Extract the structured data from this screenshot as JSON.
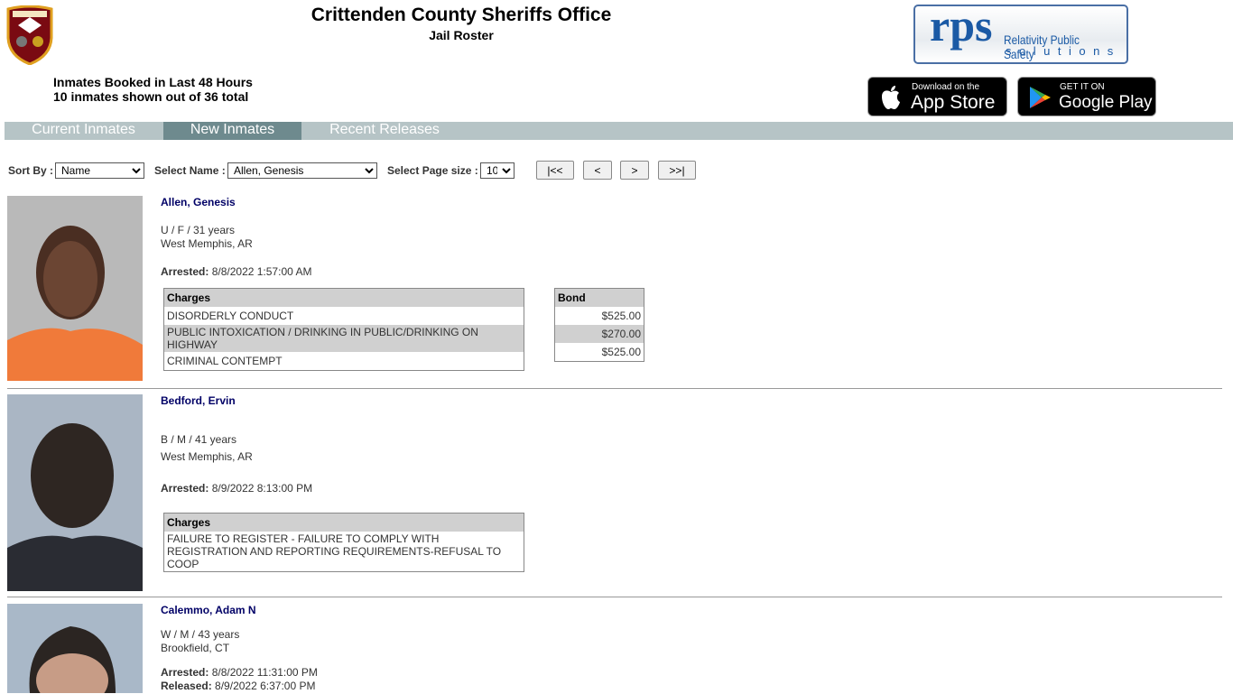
{
  "header": {
    "title": "Crittenden County Sheriffs Office",
    "subtitle": "Jail Roster",
    "summary_line1": "Inmates Booked in Last 48 Hours",
    "summary_line2": "10 inmates shown out of 36 total"
  },
  "logos": {
    "sheriff": "CRITTENDEN CO. SHERIFF",
    "rps_big": "rps",
    "rps_line1": "Relativity Public Safety",
    "rps_line2": "solutions"
  },
  "stores": {
    "apple_small": "Download on the",
    "apple_large": "App Store",
    "google_small": "GET IT ON",
    "google_large": "Google Play"
  },
  "tabs": [
    {
      "label": "Current Inmates",
      "active": false
    },
    {
      "label": "New Inmates",
      "active": true
    },
    {
      "label": "Recent Releases",
      "active": false
    }
  ],
  "controls": {
    "sort_label": "Sort By :",
    "sort_value": "Name",
    "name_label": "Select Name :",
    "name_value": "Allen, Genesis",
    "page_size_label": "Select Page size :",
    "page_size_value": "10",
    "first": "|<<",
    "prev": "<",
    "next": ">",
    "last": ">>|"
  },
  "inmates": [
    {
      "name": "Allen, Genesis",
      "demographics": "U / F / 31 years",
      "city": "West Memphis, AR",
      "arrested_label": "Arrested:",
      "arrested": "8/8/2022 1:57:00 AM",
      "charges_header": "Charges",
      "bond_header": "Bond",
      "charges": [
        "DISORDERLY CONDUCT",
        "PUBLIC INTOXICATION / DRINKING IN PUBLIC/DRINKING ON HIGHWAY",
        "CRIMINAL CONTEMPT"
      ],
      "bonds": [
        "$525.00",
        "$270.00",
        "$525.00"
      ]
    },
    {
      "name": "Bedford, Ervin",
      "demographics": "B / M / 41 years",
      "city": "West Memphis, AR",
      "arrested_label": "Arrested:",
      "arrested": "8/9/2022 8:13:00 PM",
      "charges_header": "Charges",
      "charges": [
        "FAILURE TO REGISTER - FAILURE TO COMPLY WITH REGISTRATION AND REPORTING REQUIREMENTS-REFUSAL TO COOP"
      ]
    },
    {
      "name": "Calemmo, Adam N",
      "demographics": "W / M / 43 years",
      "city": "Brookfield, CT",
      "arrested_label": "Arrested:",
      "arrested": "8/8/2022 11:31:00 PM",
      "released_label": "Released:",
      "released": "8/9/2022 6:37:00 PM"
    }
  ]
}
